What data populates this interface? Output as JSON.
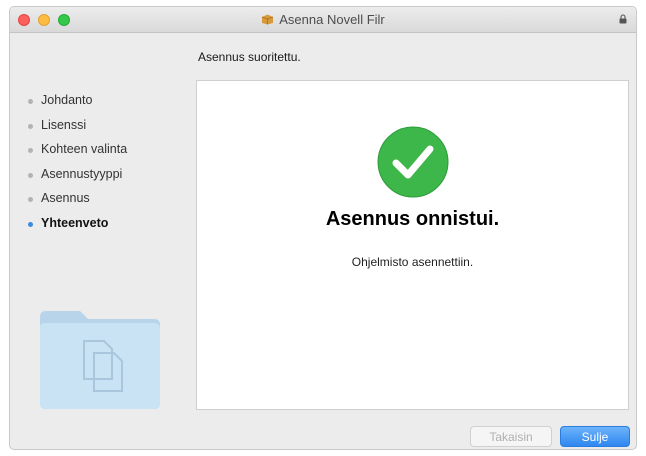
{
  "window": {
    "title": "Asenna Novell Filr",
    "title_icon": "package-icon",
    "lock_icon": "lock-icon"
  },
  "header": {
    "status": "Asennus suoritettu."
  },
  "sidebar": {
    "items": [
      {
        "label": "Johdanto",
        "active": false
      },
      {
        "label": "Lisenssi",
        "active": false
      },
      {
        "label": "Kohteen valinta",
        "active": false
      },
      {
        "label": "Asennustyyppi",
        "active": false
      },
      {
        "label": "Asennus",
        "active": false
      },
      {
        "label": "Yhteenveto",
        "active": true
      }
    ],
    "active_color": "#3a8dde"
  },
  "main": {
    "icon": "checkmark-icon",
    "icon_color": "#3db64a",
    "heading": "Asennus onnistui.",
    "message": "Ohjelmisto asennettiin."
  },
  "footer": {
    "back_label": "Takaisin",
    "close_label": "Sulje",
    "back_enabled": false
  }
}
